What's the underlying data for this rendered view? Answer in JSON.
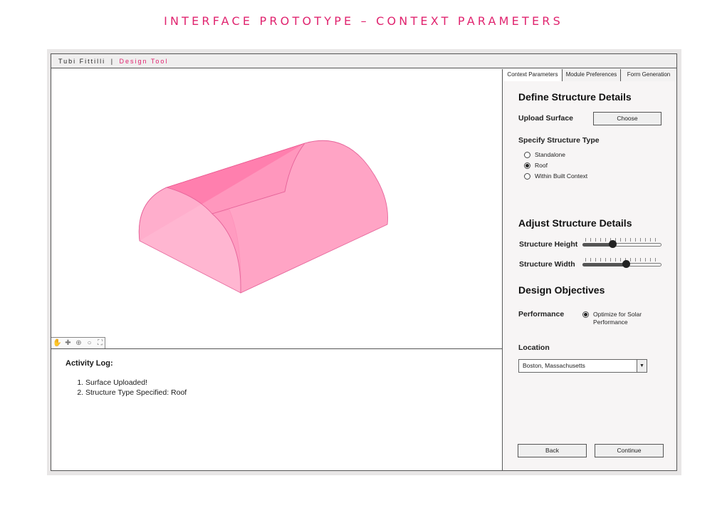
{
  "page_heading": "INTERFACE PROTOTYPE – CONTEXT PARAMETERS",
  "titlebar": {
    "brand": "Tubi Fittilli",
    "separator": "|",
    "product": "Design Tool"
  },
  "viewport": {
    "tools": [
      {
        "icon": "hand-icon",
        "glyph": "✋"
      },
      {
        "icon": "move-icon",
        "glyph": "✚"
      },
      {
        "icon": "zoom-in-icon",
        "glyph": "⊕"
      },
      {
        "icon": "zoom-icon",
        "glyph": "○"
      },
      {
        "icon": "fit-extents-icon",
        "glyph": "⛶"
      }
    ],
    "surface_color": "#ff7fae"
  },
  "activity_log": {
    "title": "Activity Log:",
    "entries": [
      "Surface Uploaded!",
      "Structure Type Specified: Roof"
    ]
  },
  "tabs": [
    {
      "label": "Context Parameters",
      "active": true
    },
    {
      "label": "Module Preferences",
      "active": false
    },
    {
      "label": "Form Generation",
      "active": false
    }
  ],
  "structure": {
    "heading": "Define Structure Details",
    "upload_label": "Upload Surface",
    "choose_button": "Choose",
    "type_label": "Specify Structure Type",
    "types": [
      {
        "label": "Standalone",
        "selected": false
      },
      {
        "label": "Roof",
        "selected": true
      },
      {
        "label": "Within Built Context",
        "selected": false
      }
    ]
  },
  "adjust": {
    "heading": "Adjust Structure Details",
    "height_label": "Structure Height",
    "height_value": 0.38,
    "width_label": "Structure Width",
    "width_value": 0.55
  },
  "objectives": {
    "heading": "Design Objectives",
    "performance_label": "Performance",
    "performance_option_line1": "Optimize for Solar",
    "performance_option_line2": "Performance",
    "performance_selected": true
  },
  "location": {
    "label": "Location",
    "selected": "Boston, Massachusetts"
  },
  "footer": {
    "back_button": "Back",
    "continue_button": "Continue"
  },
  "colors": {
    "accent": "#e0246f",
    "surface": "#ff7fae"
  }
}
